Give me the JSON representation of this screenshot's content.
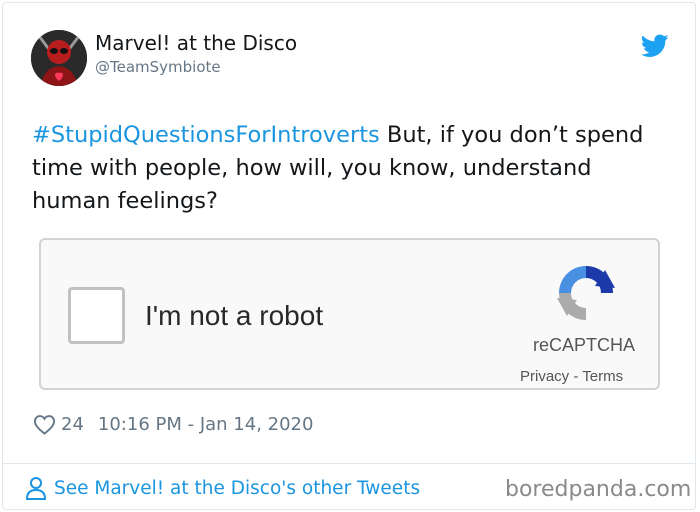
{
  "tweet": {
    "author": {
      "display_name": "Marvel! at the Disco",
      "handle": "@TeamSymbiote",
      "avatar_icon": "deadpool-avatar-icon"
    },
    "platform_icon": "twitter-bird-icon",
    "text": {
      "hashtag": "#StupidQuestionsForIntroverts",
      "body": " But, if you don’t spend time with people, how will, you know, understand human feelings?"
    },
    "media": {
      "checkbox_label": "I'm not a robot",
      "brand": "reCAPTCHA",
      "links": "Privacy - Terms",
      "logo_icon": "recaptcha-logo-icon"
    },
    "likes": "24",
    "timestamp": "10:16 PM - Jan 14, 2020",
    "footer_link": "See Marvel! at the Disco's other Tweets"
  },
  "watermark": "boredpanda.com",
  "colors": {
    "link_blue": "#1b95e0",
    "text": "#14171a",
    "muted": "#657786",
    "border": "#e1e8ed"
  }
}
